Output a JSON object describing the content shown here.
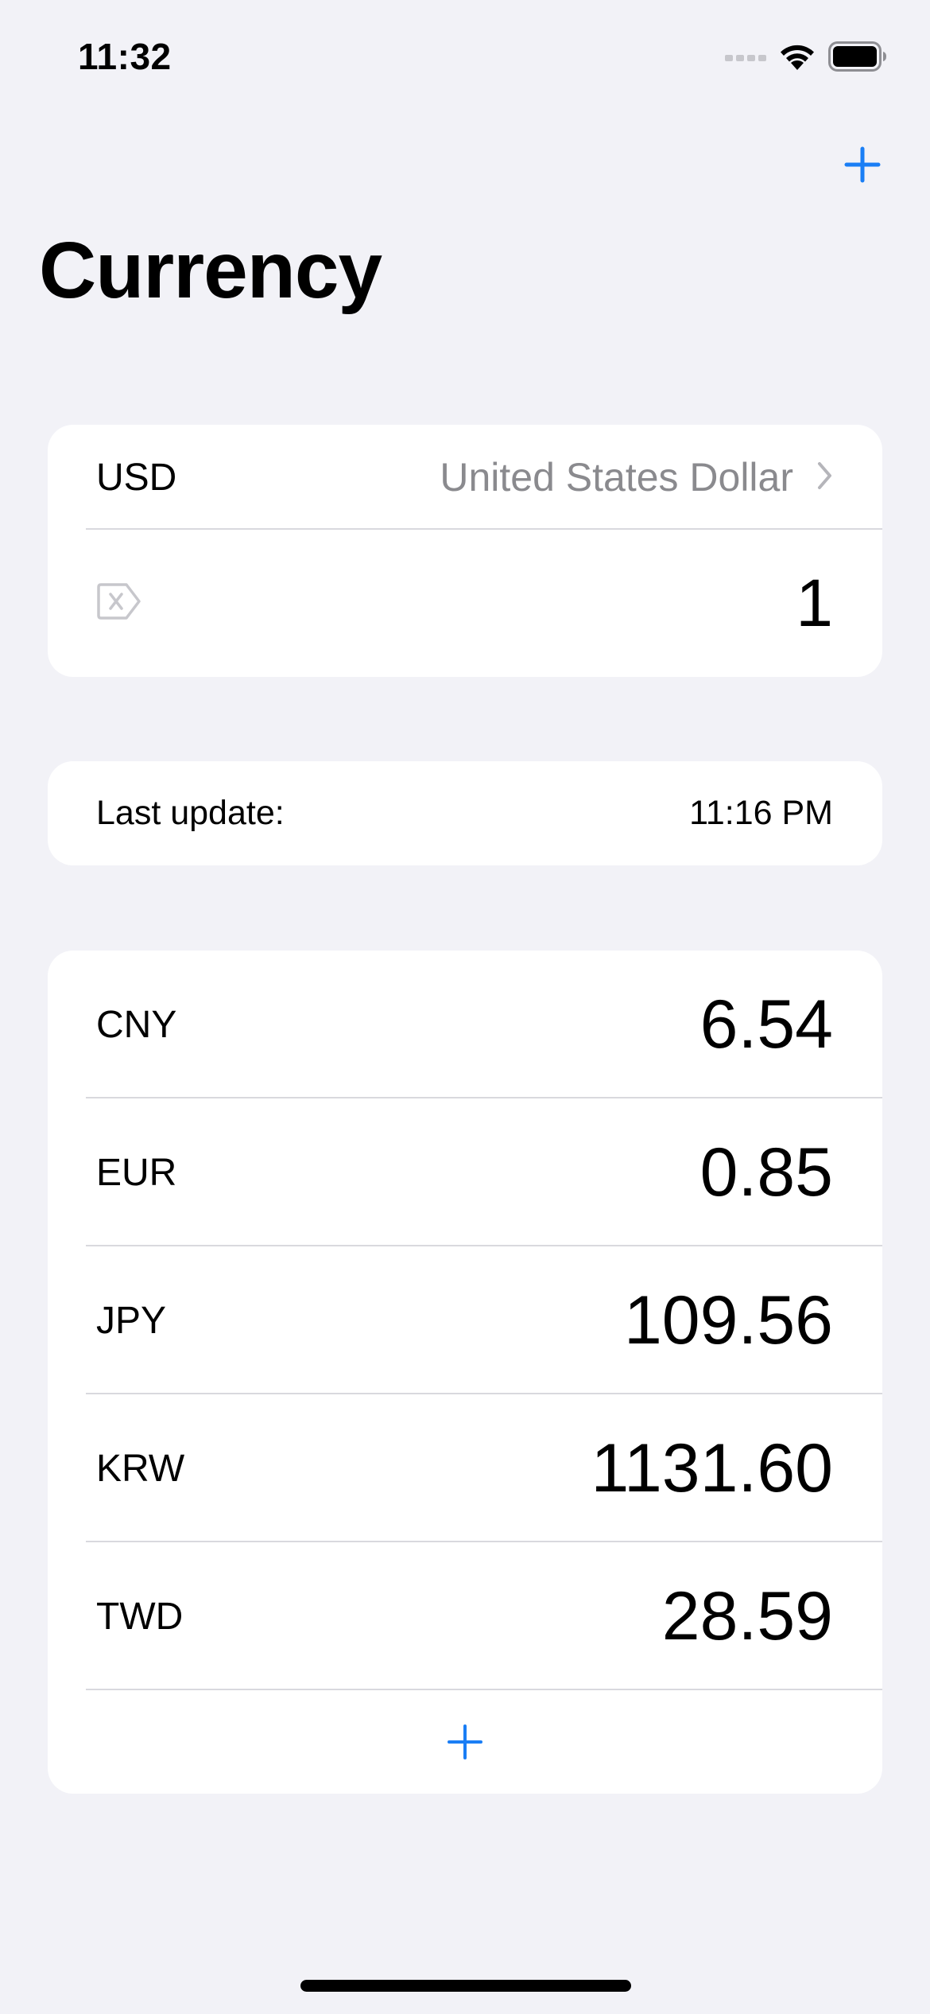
{
  "status_bar": {
    "time": "11:32",
    "icons": [
      "cellular-signal-icon",
      "wifi-icon",
      "battery-icon"
    ]
  },
  "nav": {
    "add_icon": "plus-icon",
    "title": "Currency"
  },
  "base": {
    "code": "USD",
    "name": "United States Dollar",
    "chevron_icon": "chevron-right-icon",
    "clear_icon": "clear-tag-icon",
    "amount": "1"
  },
  "update": {
    "label": "Last update:",
    "time": "11:16 PM"
  },
  "rates": [
    {
      "code": "CNY",
      "value": "6.54"
    },
    {
      "code": "EUR",
      "value": "0.85"
    },
    {
      "code": "JPY",
      "value": "109.56"
    },
    {
      "code": "KRW",
      "value": "1131.60"
    },
    {
      "code": "TWD",
      "value": "28.59"
    }
  ],
  "add_currency_icon": "plus-icon",
  "colors": {
    "accent": "#1a7ef5",
    "background": "#f2f2f7",
    "secondary_text": "#8a8a8e"
  }
}
